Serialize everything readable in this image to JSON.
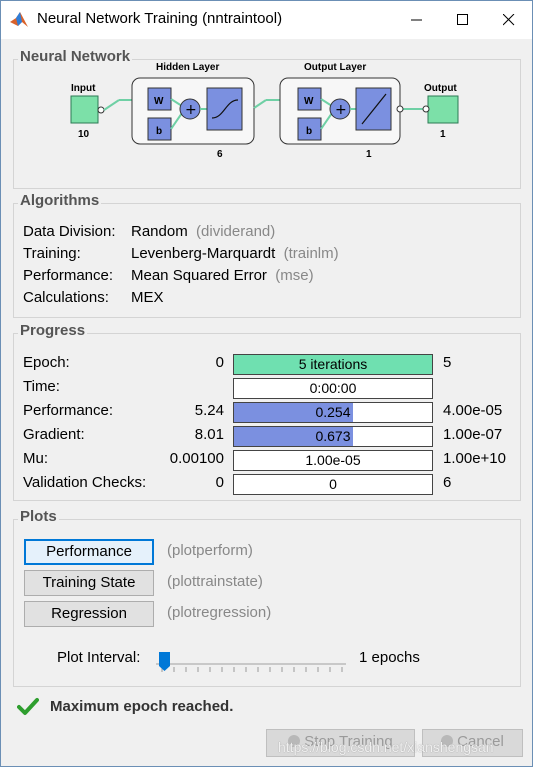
{
  "window": {
    "title": "Neural Network Training (nntraintool)"
  },
  "network": {
    "section_title": "Neural Network",
    "input_label": "Input",
    "input_size": "10",
    "hidden_label": "Hidden Layer",
    "hidden_size": "6",
    "output_layer_label": "Output Layer",
    "output_layer_size": "1",
    "output_label": "Output",
    "output_size": "1",
    "weight_label": "W",
    "bias_label": "b"
  },
  "algorithms": {
    "section_title": "Algorithms",
    "rows": [
      {
        "label": "Data Division:",
        "value": "Random",
        "func": "(dividerand)"
      },
      {
        "label": "Training:",
        "value": "Levenberg-Marquardt",
        "func": "(trainlm)"
      },
      {
        "label": "Performance:",
        "value": "Mean Squared Error",
        "func": "(mse)"
      },
      {
        "label": "Calculations:",
        "value": "MEX",
        "func": ""
      }
    ]
  },
  "progress": {
    "section_title": "Progress",
    "rows": [
      {
        "label": "Epoch:",
        "start": "0",
        "bar_text": "5 iterations",
        "end": "5",
        "fill": 1.0,
        "fill_color": "#6fe0b0"
      },
      {
        "label": "Time:",
        "start": "",
        "bar_text": "0:00:00",
        "end": "",
        "fill": 0.0,
        "fill_color": "#ffffff"
      },
      {
        "label": "Performance:",
        "start": "5.24",
        "bar_text": "0.254",
        "end": "4.00e-05",
        "fill": 0.6,
        "fill_color": "#7b90e0"
      },
      {
        "label": "Gradient:",
        "start": "8.01",
        "bar_text": "0.673",
        "end": "1.00e-07",
        "fill": 0.6,
        "fill_color": "#7b90e0"
      },
      {
        "label": "Mu:",
        "start": "0.00100",
        "bar_text": "1.00e-05",
        "end": "1.00e+10",
        "fill": 0.0,
        "fill_color": "#ffffff"
      },
      {
        "label": "Validation Checks:",
        "start": "0",
        "bar_text": "0",
        "end": "6",
        "fill": 0.0,
        "fill_color": "#ffffff"
      }
    ]
  },
  "plots": {
    "section_title": "Plots",
    "buttons": [
      {
        "label": "Performance",
        "func": "(plotperform)"
      },
      {
        "label": "Training State",
        "func": "(plottrainstate)"
      },
      {
        "label": "Regression",
        "func": "(plotregression)"
      }
    ],
    "interval_label": "Plot Interval:",
    "interval_value": "1 epochs",
    "slider_level": 0.0
  },
  "status": {
    "message": "Maximum epoch reached."
  },
  "footer": {
    "stop_label": "Stop Training",
    "cancel_label": "Cancel",
    "watermark": "https://blog.csdn.net/xianshengsan"
  },
  "colors": {
    "accent": "#0078d7",
    "success": "#2e9e2e",
    "epoch_fill": "#6fe0b0",
    "perf_fill": "#7b90e0"
  }
}
